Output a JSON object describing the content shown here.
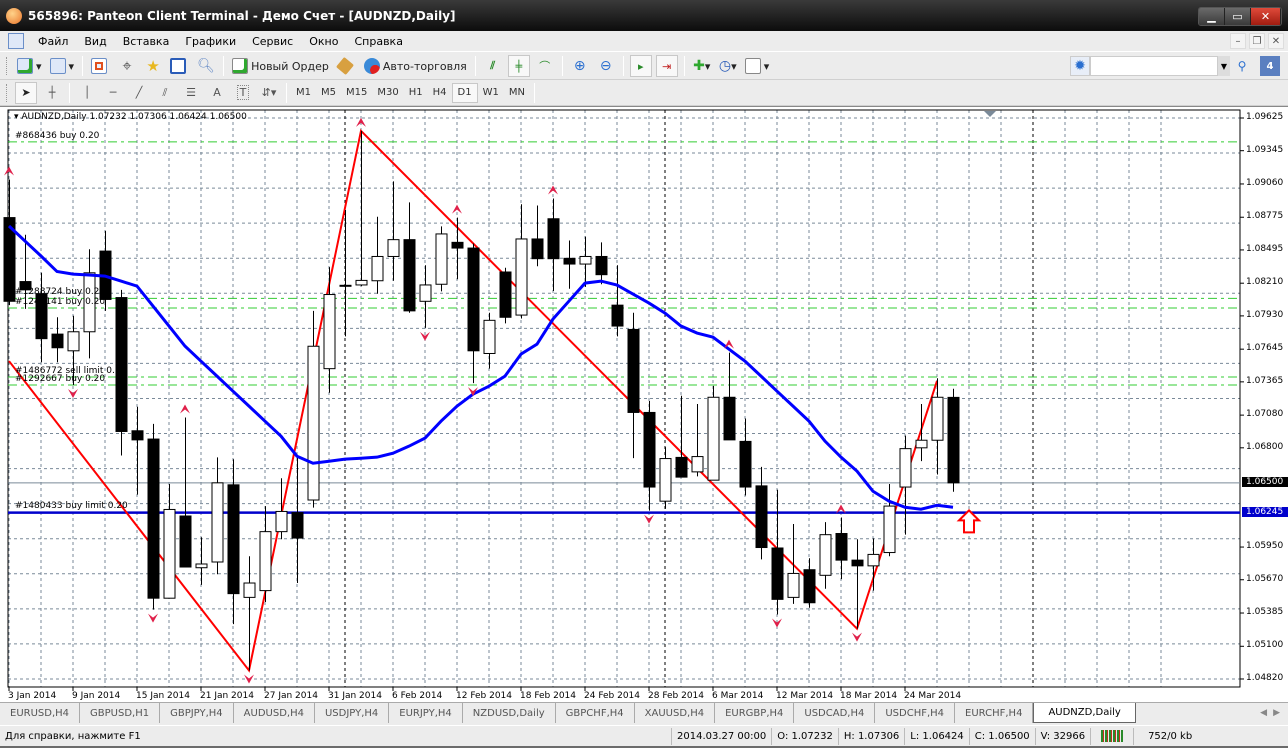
{
  "window": {
    "title": "565896: Panteon Client Terminal - Демо Счет - [AUDNZD,Daily]",
    "minimize": "▁",
    "maximize": "▭",
    "close": "✕"
  },
  "menu": [
    "Файл",
    "Вид",
    "Вставка",
    "Графики",
    "Сервис",
    "Окно",
    "Справка"
  ],
  "mdi_controls": [
    "–",
    "❐",
    "✕"
  ],
  "toolbar1": {
    "new_order_label": "Новый Ордер",
    "autotrading_label": "Авто-торговля",
    "search_placeholder": "",
    "search_value": "",
    "notifications_count": "4"
  },
  "toolbar2": {
    "text_tool": "A",
    "label_tool": "T",
    "timeframes": [
      "M1",
      "M5",
      "M15",
      "M30",
      "H1",
      "H4",
      "D1",
      "W1",
      "MN"
    ],
    "active_timeframe": "D1"
  },
  "chart": {
    "header": "AUDNZD,Daily  1.07232 1.07306 1.06424 1.06500",
    "colors": {
      "bull_fill": "#ffffff",
      "bear_fill": "#000000",
      "ma": "#0000ff",
      "zigzag": "#ff0000",
      "order_line": "#33cc33",
      "bid_line": "#7a8a99",
      "grid": "#7a8a99",
      "fractal": "#e0204a",
      "pending_line": "#0000cc"
    }
  },
  "chart_data": {
    "type": "candlestick",
    "symbol": "AUDNZD",
    "timeframe": "Daily",
    "ylim": [
      1.0476,
      1.0968
    ],
    "price_ticks": [
      "1.09625",
      "1.09345",
      "1.09060",
      "1.08775",
      "1.08495",
      "1.08210",
      "1.07930",
      "1.07645",
      "1.07365",
      "1.07080",
      "1.06800",
      "1.05950",
      "1.05670",
      "1.05385",
      "1.05100",
      "1.04820"
    ],
    "bid": {
      "label": "1.06500",
      "value": 1.065
    },
    "pending_price": {
      "label": "1.06245",
      "value": 1.06245
    },
    "date_labels": [
      {
        "bar": 0,
        "text": "3 Jan 2014"
      },
      {
        "bar": 4,
        "text": "9 Jan 2014"
      },
      {
        "bar": 8,
        "text": "15 Jan 2014"
      },
      {
        "bar": 12,
        "text": "21 Jan 2014"
      },
      {
        "bar": 16,
        "text": "27 Jan 2014"
      },
      {
        "bar": 20,
        "text": "31 Jan 2014"
      },
      {
        "bar": 24,
        "text": "6 Feb 2014"
      },
      {
        "bar": 28,
        "text": "12 Feb 2014"
      },
      {
        "bar": 32,
        "text": "18 Feb 2014"
      },
      {
        "bar": 36,
        "text": "24 Feb 2014"
      },
      {
        "bar": 40,
        "text": "28 Feb 2014"
      },
      {
        "bar": 44,
        "text": "6 Mar 2014"
      },
      {
        "bar": 48,
        "text": "12 Mar 2014"
      },
      {
        "bar": 52,
        "text": "18 Mar 2014"
      },
      {
        "bar": 56,
        "text": "24 Mar 2014"
      }
    ],
    "period_separators": [
      21,
      41,
      64
    ],
    "ohlc": [
      [
        1.08772,
        1.09098,
        1.08022,
        1.08055
      ],
      [
        1.08224,
        1.08625,
        1.0799,
        1.08153
      ],
      [
        1.0812,
        1.08299,
        1.07533,
        1.07735
      ],
      [
        1.07774,
        1.07918,
        1.07533,
        1.07657
      ],
      [
        1.07631,
        1.07931,
        1.07338,
        1.07794
      ],
      [
        1.07794,
        1.08501,
        1.07566,
        1.08299
      ],
      [
        1.08485,
        1.08658,
        1.07973,
        1.08071
      ],
      [
        1.08087,
        1.08153,
        1.06734,
        1.0694
      ],
      [
        1.06946,
        1.07152,
        1.06399,
        1.06868
      ],
      [
        1.06875,
        1.07005,
        1.05414,
        1.05512
      ],
      [
        1.05512,
        1.0649,
        1.05512,
        1.06272
      ],
      [
        1.06216,
        1.0706,
        1.05779,
        1.05779
      ],
      [
        1.05773,
        1.06034,
        1.05626,
        1.05805
      ],
      [
        1.05822,
        1.06718,
        1.05717,
        1.065
      ],
      [
        1.06483,
        1.06702,
        1.0529,
        1.05551
      ],
      [
        1.05519,
        1.05871,
        1.04893,
        1.05642
      ],
      [
        1.05577,
        1.06301,
        1.05479,
        1.06082
      ],
      [
        1.06082,
        1.06539,
        1.06017,
        1.06255
      ],
      [
        1.06245,
        1.06718,
        1.05642,
        1.06027
      ],
      [
        1.06353,
        1.07973,
        1.06288,
        1.0767
      ],
      [
        1.07478,
        1.08348,
        1.07272,
        1.08113
      ],
      [
        1.08192,
        1.08837,
        1.07755,
        1.08185
      ],
      [
        1.08195,
        1.09515,
        1.08185,
        1.08234
      ],
      [
        1.08231,
        1.08779,
        1.0812,
        1.08439
      ],
      [
        1.08439,
        1.09082,
        1.08231,
        1.08583
      ],
      [
        1.08583,
        1.08902,
        1.07957,
        1.07973
      ],
      [
        1.08055,
        1.08364,
        1.07827,
        1.08195
      ],
      [
        1.08201,
        1.08697,
        1.0814,
        1.08632
      ],
      [
        1.0856,
        1.08772,
        1.08244,
        1.08511
      ],
      [
        1.08511,
        1.0855,
        1.07354,
        1.07631
      ],
      [
        1.07608,
        1.07957,
        1.07478,
        1.07892
      ],
      [
        1.08306,
        1.08342,
        1.07866,
        1.07918
      ],
      [
        1.07937,
        1.08886,
        1.07908,
        1.08589
      ],
      [
        1.08589,
        1.08876,
        1.08355,
        1.0842
      ],
      [
        1.08762,
        1.08935,
        1.08143,
        1.0842
      ],
      [
        1.08423,
        1.08576,
        1.08162,
        1.08374
      ],
      [
        1.08374,
        1.08609,
        1.08179,
        1.08439
      ],
      [
        1.08439,
        1.0856,
        1.08201,
        1.08283
      ],
      [
        1.08022,
        1.08364,
        1.07755,
        1.07843
      ],
      [
        1.07814,
        1.07957,
        1.06712,
        1.07103
      ],
      [
        1.07103,
        1.07201,
        1.06262,
        1.06464
      ],
      [
        1.06343,
        1.06806,
        1.06278,
        1.06708
      ],
      [
        1.06718,
        1.07246,
        1.06549,
        1.06549
      ],
      [
        1.06594,
        1.07175,
        1.06555,
        1.06725
      ],
      [
        1.06523,
        1.07331,
        1.06523,
        1.07233
      ],
      [
        1.07233,
        1.07615,
        1.06868,
        1.06868
      ],
      [
        1.06855,
        1.07051,
        1.06392,
        1.06464
      ],
      [
        1.06474,
        1.06637,
        1.05845,
        1.05946
      ],
      [
        1.05942,
        1.06441,
        1.05372,
        1.05502
      ],
      [
        1.05519,
        1.06148,
        1.05463,
        1.05724
      ],
      [
        1.05756,
        1.05854,
        1.0543,
        1.05473
      ],
      [
        1.05708,
        1.06164,
        1.05593,
        1.06056
      ],
      [
        1.06066,
        1.06203,
        1.05675,
        1.05838
      ],
      [
        1.05838,
        1.06017,
        1.05251,
        1.05789
      ],
      [
        1.05789,
        1.06024,
        1.05577,
        1.05887
      ],
      [
        1.05903,
        1.0649,
        1.05871,
        1.06301
      ],
      [
        1.06464,
        1.06904,
        1.06056,
        1.06793
      ],
      [
        1.068,
        1.07175,
        1.06686,
        1.06865
      ],
      [
        1.06865,
        1.07396,
        1.06571,
        1.07233
      ],
      [
        1.07232,
        1.07306,
        1.06424,
        1.065
      ]
    ],
    "moving_average": [
      1.087,
      1.08571,
      1.08443,
      1.0831,
      1.08288,
      1.0828,
      1.08271,
      1.08228,
      1.08185,
      1.08014,
      1.07843,
      1.07671,
      1.07542,
      1.07414,
      1.07285,
      1.07157,
      1.07028,
      1.069,
      1.06728,
      1.06668,
      1.06685,
      1.06703,
      1.06711,
      1.0672,
      1.06754,
      1.06814,
      1.06883,
      1.07028,
      1.07157,
      1.0726,
      1.07328,
      1.07414,
      1.07603,
      1.07688,
      1.07903,
      1.08057,
      1.08211,
      1.08228,
      1.08194,
      1.08117,
      1.0804,
      1.07954,
      1.07843,
      1.07783,
      1.07748,
      1.07645,
      1.07542,
      1.07414,
      1.07285,
      1.07157,
      1.07028,
      1.06857,
      1.0672,
      1.066,
      1.06428,
      1.06343,
      1.06291,
      1.06274,
      1.06308,
      1.06291
    ],
    "zigzag": [
      {
        "bar": 0,
        "price": 1.07543
      },
      {
        "bar": 15,
        "price": 1.04893
      },
      {
        "bar": 22,
        "price": 1.09515
      },
      {
        "bar": 53,
        "price": 1.05251
      },
      {
        "bar": 58,
        "price": 1.07373
      }
    ],
    "fractals_up": [
      0,
      11,
      22,
      28,
      34,
      45,
      52
    ],
    "fractals_down": [
      4,
      9,
      15,
      26,
      29,
      40,
      48,
      53
    ],
    "buy_arrow": {
      "bar": 61,
      "price": 1.0617
    },
    "orders": [
      {
        "label": "#868436 buy 0.20",
        "price": 1.0942
      },
      {
        "label": "#1288724 buy 0.20",
        "price": 1.0808
      },
      {
        "label": "#1242141 buy 0.20",
        "price": 1.07998
      },
      {
        "label": "#1486772 sell limit 0.20",
        "price": 1.07407
      },
      {
        "label": "#1292667 buy 0.20",
        "price": 1.07338
      },
      {
        "label": "#1480433 buy limit 0.20",
        "price": 1.0625
      }
    ]
  },
  "tabs": [
    "EURUSD,H4",
    "GBPUSD,H1",
    "GBPJPY,H4",
    "AUDUSD,H4",
    "USDJPY,H4",
    "EURJPY,H4",
    "NZDUSD,Daily",
    "GBPCHF,H4",
    "XAUUSD,H4",
    "EURGBP,H4",
    "USDCAD,H4",
    "USDCHF,H4",
    "EURCHF,H4",
    "AUDNZD,Daily"
  ],
  "active_tab": "AUDNZD,Daily",
  "tab_scroll": [
    "◀",
    "▶"
  ],
  "status": {
    "help": "Для справки, нажмите F1",
    "datetime": "2014.03.27 00:00",
    "open": "O: 1.07232",
    "high": "H: 1.07306",
    "low": "L: 1.06424",
    "close": "C: 1.06500",
    "volume": "V: 32966",
    "traffic": "752/0 kb"
  }
}
